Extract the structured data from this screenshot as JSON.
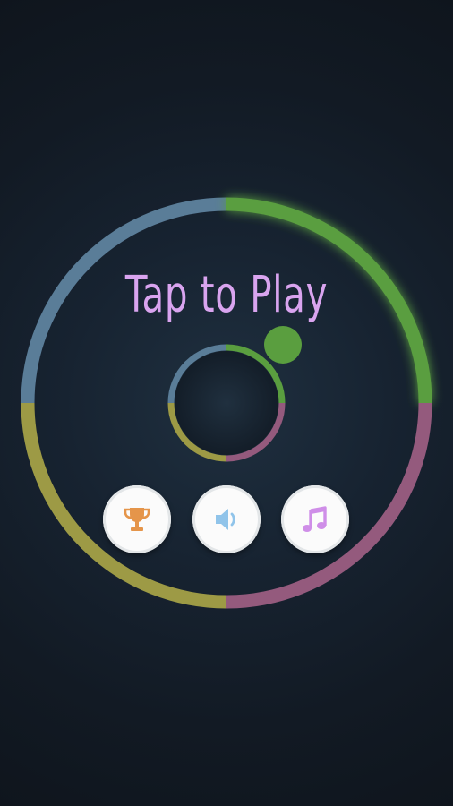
{
  "screen": {
    "title": "Tap to Play"
  },
  "colors": {
    "background": "#121a24",
    "ring_blue": "#5a7d98",
    "ring_green": "#5a9e3f",
    "ring_pink": "#945a7d",
    "ring_olive": "#9d9a45",
    "ball": "#5a9e3f",
    "title": "#d9a4ef",
    "trophy": "#e5954a",
    "sound": "#90c4ea",
    "music": "#cf8ee8"
  },
  "buttons": [
    {
      "id": "leaderboard",
      "icon": "trophy-icon"
    },
    {
      "id": "sound",
      "icon": "speaker-icon"
    },
    {
      "id": "music",
      "icon": "music-note-icon"
    }
  ]
}
